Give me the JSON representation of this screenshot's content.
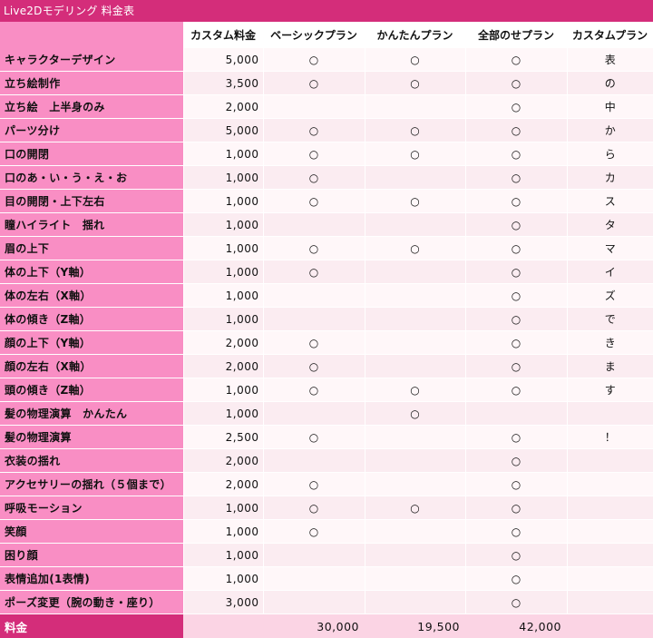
{
  "title": "Live2Dモデリング 料金表",
  "headers": [
    "カスタム料金",
    "ベーシックプラン",
    "かんたんプラン",
    "全部のせプラン",
    "カスタムプラン"
  ],
  "rows": [
    {
      "feature": "キャラクターデザイン",
      "price": "5,000",
      "basic": "○",
      "easy": "○",
      "full": "○",
      "custom": "表"
    },
    {
      "feature": "立ち絵制作",
      "price": "3,500",
      "basic": "○",
      "easy": "○",
      "full": "○",
      "custom": "の"
    },
    {
      "feature": "立ち絵　上半身のみ",
      "price": "2,000",
      "basic": "",
      "easy": "",
      "full": "○",
      "custom": "中"
    },
    {
      "feature": "パーツ分け",
      "price": "5,000",
      "basic": "○",
      "easy": "○",
      "full": "○",
      "custom": "か"
    },
    {
      "feature": "口の開閉",
      "price": "1,000",
      "basic": "○",
      "easy": "○",
      "full": "○",
      "custom": "ら"
    },
    {
      "feature": "口のあ・い・う・え・お",
      "price": "1,000",
      "basic": "○",
      "easy": "",
      "full": "○",
      "custom": "カ"
    },
    {
      "feature": "目の開閉・上下左右",
      "price": "1,000",
      "basic": "○",
      "easy": "○",
      "full": "○",
      "custom": "ス"
    },
    {
      "feature": "瞳ハイライト　揺れ",
      "price": "1,000",
      "basic": "",
      "easy": "",
      "full": "○",
      "custom": "タ"
    },
    {
      "feature": "眉の上下",
      "price": "1,000",
      "basic": "○",
      "easy": "○",
      "full": "○",
      "custom": "マ"
    },
    {
      "feature": "体の上下（Y軸）",
      "price": "1,000",
      "basic": "○",
      "easy": "",
      "full": "○",
      "custom": "イ"
    },
    {
      "feature": "体の左右（X軸）",
      "price": "1,000",
      "basic": "",
      "easy": "",
      "full": "○",
      "custom": "ズ"
    },
    {
      "feature": "体の傾き（Z軸）",
      "price": "1,000",
      "basic": "",
      "easy": "",
      "full": "○",
      "custom": "で"
    },
    {
      "feature": "顔の上下（Y軸）",
      "price": "2,000",
      "basic": "○",
      "easy": "",
      "full": "○",
      "custom": "き"
    },
    {
      "feature": "顔の左右（X軸）",
      "price": "2,000",
      "basic": "○",
      "easy": "",
      "full": "○",
      "custom": "ま"
    },
    {
      "feature": "頭の傾き（Z軸）",
      "price": "1,000",
      "basic": "○",
      "easy": "○",
      "full": "○",
      "custom": "す"
    },
    {
      "feature": "髪の物理演算　かんたん",
      "price": "1,000",
      "basic": "",
      "easy": "○",
      "full": "",
      "custom": ""
    },
    {
      "feature": "髪の物理演算",
      "price": "2,500",
      "basic": "○",
      "easy": "",
      "full": "○",
      "custom": "！"
    },
    {
      "feature": "衣装の揺れ",
      "price": "2,000",
      "basic": "",
      "easy": "",
      "full": "○",
      "custom": ""
    },
    {
      "feature": "アクセサリーの揺れ（５個まで）",
      "price": "2,000",
      "basic": "○",
      "easy": "",
      "full": "○",
      "custom": ""
    },
    {
      "feature": "呼吸モーション",
      "price": "1,000",
      "basic": "○",
      "easy": "○",
      "full": "○",
      "custom": ""
    },
    {
      "feature": "笑顔",
      "price": "1,000",
      "basic": "○",
      "easy": "",
      "full": "○",
      "custom": ""
    },
    {
      "feature": "困り顔",
      "price": "1,000",
      "basic": "",
      "easy": "",
      "full": "○",
      "custom": ""
    },
    {
      "feature": "表情追加(1表情)",
      "price": "1,000",
      "basic": "",
      "easy": "",
      "full": "○",
      "custom": ""
    },
    {
      "feature": "ポーズ変更（腕の動き・座り）",
      "price": "3,000",
      "basic": "",
      "easy": "",
      "full": "○",
      "custom": ""
    }
  ],
  "total": {
    "label": "料金",
    "custom_price": "",
    "basic": "30,000",
    "easy": "19,500",
    "full": "42,000",
    "custom": ""
  },
  "colors": {
    "title_bg": "#d42d7a",
    "label_bg": "#f98ec4",
    "cell_odd": "#fbecf1",
    "cell_even": "#fff7f9",
    "total_bg": "#fbd4e4"
  }
}
